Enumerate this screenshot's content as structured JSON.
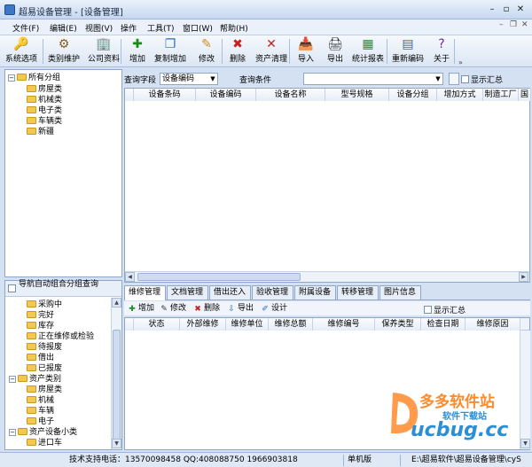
{
  "window": {
    "title": "超易设备管理 - [设备管理]"
  },
  "menu": [
    "文件(F)",
    "编辑(E)",
    "视图(V)",
    "操作",
    "工具(T)",
    "窗口(W)",
    "帮助(H)"
  ],
  "toolbar": [
    {
      "label": "系统选项",
      "icon": "key-icon",
      "glyph": "🔑"
    },
    {
      "label": "类别维护",
      "icon": "gear-icon",
      "glyph": "⚙"
    },
    {
      "label": "公司资料",
      "icon": "building-icon",
      "glyph": "🏢"
    },
    {
      "label": "增加",
      "icon": "add-person-icon",
      "glyph": "✚"
    },
    {
      "label": "复制增加",
      "icon": "copy-add-icon",
      "glyph": "❐"
    },
    {
      "label": "修改",
      "icon": "pencil-icon",
      "glyph": "✎"
    },
    {
      "label": "删除",
      "icon": "delete-x-icon",
      "glyph": "✖"
    },
    {
      "label": "资产清理",
      "icon": "clear-x-icon",
      "glyph": "✕"
    },
    {
      "label": "导入",
      "icon": "import-icon",
      "glyph": "📥"
    },
    {
      "label": "导出",
      "icon": "printer-icon",
      "glyph": "🖨"
    },
    {
      "label": "统计报表",
      "icon": "bar-chart-icon",
      "glyph": "▦"
    },
    {
      "label": "重新编码",
      "icon": "recode-icon",
      "glyph": "▤"
    },
    {
      "label": "关于",
      "icon": "help-icon",
      "glyph": "?"
    }
  ],
  "tree_top": {
    "root": "所有分组",
    "children": [
      "房屋类",
      "机械类",
      "电子类",
      "车辆类",
      "新疆"
    ]
  },
  "tree_bottom": {
    "header": "导航自动组合分组查询",
    "groups": [
      {
        "label": "采购中",
        "level": 1
      },
      {
        "label": "完好",
        "level": 1
      },
      {
        "label": "库存",
        "level": 1
      },
      {
        "label": "正在维修或检验",
        "level": 1
      },
      {
        "label": "待报废",
        "level": 1
      },
      {
        "label": "借出",
        "level": 1
      },
      {
        "label": "已报废",
        "level": 1
      },
      {
        "label": "资产类别",
        "level": 0
      },
      {
        "label": "房屋类",
        "level": 1
      },
      {
        "label": "机械",
        "level": 1
      },
      {
        "label": "车辆",
        "level": 1
      },
      {
        "label": "电子",
        "level": 1
      },
      {
        "label": "资产设备小类",
        "level": 0
      },
      {
        "label": "进口车",
        "level": 1
      }
    ]
  },
  "query": {
    "field_label": "查询字段",
    "field_value": "设备编码",
    "condition_label": "查询条件",
    "condition_value": "",
    "show_summary": "显示汇总"
  },
  "main_table": {
    "columns": [
      "设备条码",
      "设备编码",
      "设备名称",
      "型号规格",
      "设备分组",
      "增加方式",
      "制造工厂",
      "国"
    ]
  },
  "tabs": [
    "维修管理",
    "文档管理",
    "借出还入",
    "验收管理",
    "附属设备",
    "转移管理",
    "图片信息"
  ],
  "sub_toolbar": {
    "buttons": [
      {
        "label": "增加",
        "icon": "add-icon",
        "glyph": "✚",
        "color": "#1a8a1a"
      },
      {
        "label": "修改",
        "icon": "edit-icon",
        "glyph": "✎",
        "color": "#333"
      },
      {
        "label": "删除",
        "icon": "delete-icon",
        "glyph": "✖",
        "color": "#c81e1e"
      },
      {
        "label": "导出",
        "icon": "export-icon",
        "glyph": "⇩",
        "color": "#2a6bc0"
      },
      {
        "label": "设计",
        "icon": "design-icon",
        "glyph": "✐",
        "color": "#2a6bc0"
      }
    ],
    "show_summary": "显示汇总"
  },
  "sub_table": {
    "columns": [
      "状态",
      "外部维修",
      "维修单位",
      "维修总额",
      "维修编号",
      "保养类型",
      "检查日期",
      "维修原因"
    ]
  },
  "status": {
    "phone": "技术支持电话：13570098458 QQ:408088750 1966903818",
    "edition": "单机版",
    "path": "E:\\超易软件\\超易设备管理\\cyS"
  },
  "watermark": {
    "line1": "多多软件站",
    "line2": "软件下载站",
    "logo": "ucbug.cc"
  }
}
